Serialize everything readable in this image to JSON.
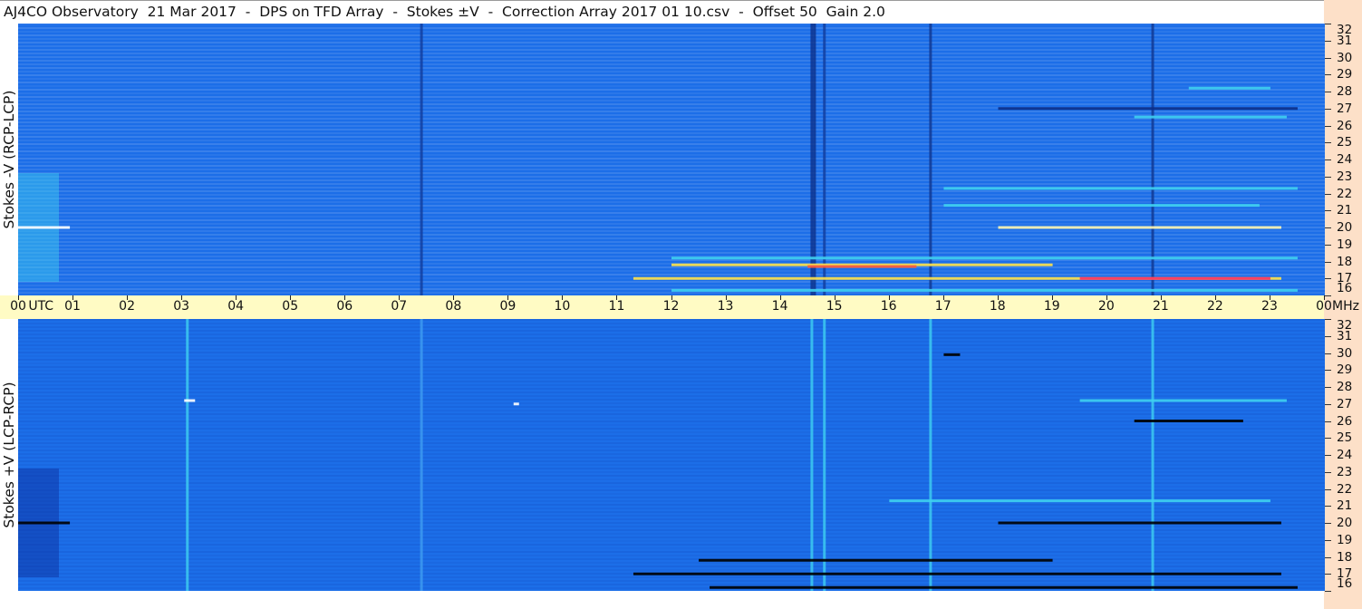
{
  "title": "AJ4CO Observatory  21 Mar 2017  -  DPS on TFD Array  -  Stokes ±V  -  Correction Array 2017 01 10.csv  -  Offset 50  Gain 2.0",
  "colors": {
    "background": "#1c6ee8",
    "band": "#fffbc4",
    "strip": "#fde0c8"
  },
  "chart_data": [
    {
      "type": "heatmap",
      "name_label": "Stokes -V (RCP-LCP)",
      "x_axis": {
        "unit": "UTC",
        "ticks": [
          "00",
          "01",
          "02",
          "03",
          "04",
          "05",
          "06",
          "07",
          "08",
          "09",
          "10",
          "11",
          "12",
          "13",
          "14",
          "15",
          "16",
          "17",
          "18",
          "19",
          "20",
          "21",
          "22",
          "23",
          "00"
        ]
      },
      "y_axis": {
        "unit": "MHz",
        "range": [
          16,
          32
        ],
        "ticks": [
          "32",
          "31",
          "30",
          "29",
          "28",
          "27",
          "26",
          "25",
          "24",
          "23",
          "22",
          "21",
          "20",
          "19",
          "18",
          "17",
          "16"
        ]
      },
      "colormap": [
        "#0a2c9c",
        "#1c6ee8",
        "#3fd0f0",
        "#ffe24a",
        "#ff3030"
      ],
      "features": [
        {
          "kind": "vline",
          "utc": 7.4,
          "color": "#123c9c"
        },
        {
          "kind": "vline",
          "utc": 14.57,
          "color": "#0c2f88"
        },
        {
          "kind": "vline",
          "utc": 14.62,
          "color": "#0c2f88"
        },
        {
          "kind": "vline",
          "utc": 14.8,
          "color": "#123c9c"
        },
        {
          "kind": "vline",
          "utc": 16.75,
          "color": "#10368f"
        },
        {
          "kind": "vline",
          "utc": 20.83,
          "color": "#10368f"
        },
        {
          "kind": "hseg",
          "mhz": 20.0,
          "utc_start": 0.0,
          "utc_end": 0.95,
          "color": "#ffffff"
        },
        {
          "kind": "hseg",
          "mhz": 20.0,
          "utc_start": 18.0,
          "utc_end": 23.2,
          "color": "#fff6b0"
        },
        {
          "kind": "hseg",
          "mhz": 18.2,
          "utc_start": 12.0,
          "utc_end": 23.5,
          "color": "#3fd0f0"
        },
        {
          "kind": "hseg",
          "mhz": 17.8,
          "utc_start": 12.0,
          "utc_end": 19.0,
          "color": "#ffe24a"
        },
        {
          "kind": "hseg",
          "mhz": 17.7,
          "utc_start": 14.5,
          "utc_end": 16.5,
          "color": "#ff5a3a"
        },
        {
          "kind": "hseg",
          "mhz": 17.0,
          "utc_start": 11.3,
          "utc_end": 23.2,
          "color": "#ffe24a"
        },
        {
          "kind": "hseg",
          "mhz": 17.0,
          "utc_start": 19.5,
          "utc_end": 23.0,
          "color": "#ff3060"
        },
        {
          "kind": "hseg",
          "mhz": 16.3,
          "utc_start": 12.0,
          "utc_end": 23.5,
          "color": "#3fd0f0"
        },
        {
          "kind": "hseg",
          "mhz": 22.3,
          "utc_start": 17.0,
          "utc_end": 23.5,
          "color": "#3fd0f0"
        },
        {
          "kind": "hseg",
          "mhz": 21.3,
          "utc_start": 17.0,
          "utc_end": 22.8,
          "color": "#3fd0f0"
        },
        {
          "kind": "hseg",
          "mhz": 27.0,
          "utc_start": 18.0,
          "utc_end": 23.5,
          "color": "#0c2f88"
        },
        {
          "kind": "hseg",
          "mhz": 28.2,
          "utc_start": 21.5,
          "utc_end": 23.0,
          "color": "#3fd0f0"
        },
        {
          "kind": "hseg",
          "mhz": 26.5,
          "utc_start": 20.5,
          "utc_end": 23.3,
          "color": "#3fd0f0"
        }
      ]
    },
    {
      "type": "heatmap",
      "name_label": "Stokes +V (LCP-RCP)",
      "x_axis": {
        "unit": "UTC",
        "ticks": [
          "00",
          "01",
          "02",
          "03",
          "04",
          "05",
          "06",
          "07",
          "08",
          "09",
          "10",
          "11",
          "12",
          "13",
          "14",
          "15",
          "16",
          "17",
          "18",
          "19",
          "20",
          "21",
          "22",
          "23",
          "00"
        ]
      },
      "y_axis": {
        "unit": "MHz",
        "range": [
          16,
          32
        ],
        "ticks": [
          "32",
          "31",
          "30",
          "29",
          "28",
          "27",
          "26",
          "25",
          "24",
          "23",
          "22",
          "21",
          "20",
          "19",
          "18",
          "17",
          "16"
        ]
      },
      "colormap": [
        "#000000",
        "#0a2c9c",
        "#1c6ee8",
        "#3fd0f0",
        "#ffffff"
      ],
      "features": [
        {
          "kind": "vline",
          "utc": 3.1,
          "color": "#3fd0f0"
        },
        {
          "kind": "vline",
          "utc": 7.4,
          "color": "#3f9cf0"
        },
        {
          "kind": "vline",
          "utc": 14.57,
          "color": "#3fd0f0"
        },
        {
          "kind": "vline",
          "utc": 14.8,
          "color": "#3fd0f0"
        },
        {
          "kind": "vline",
          "utc": 16.75,
          "color": "#3fd0f0"
        },
        {
          "kind": "vline",
          "utc": 20.83,
          "color": "#3fd0f0"
        },
        {
          "kind": "hseg",
          "mhz": 20.0,
          "utc_start": 0.0,
          "utc_end": 0.95,
          "color": "#000000"
        },
        {
          "kind": "hseg",
          "mhz": 20.0,
          "utc_start": 18.0,
          "utc_end": 23.2,
          "color": "#000000"
        },
        {
          "kind": "hseg",
          "mhz": 17.8,
          "utc_start": 12.5,
          "utc_end": 19.0,
          "color": "#000000"
        },
        {
          "kind": "hseg",
          "mhz": 17.0,
          "utc_start": 11.3,
          "utc_end": 23.2,
          "color": "#000000"
        },
        {
          "kind": "hseg",
          "mhz": 16.2,
          "utc_start": 12.7,
          "utc_end": 23.5,
          "color": "#000000"
        },
        {
          "kind": "hseg",
          "mhz": 21.3,
          "utc_start": 16.0,
          "utc_end": 23.0,
          "color": "#3fd0f0"
        },
        {
          "kind": "hseg",
          "mhz": 27.2,
          "utc_start": 19.5,
          "utc_end": 23.3,
          "color": "#3fd0f0"
        },
        {
          "kind": "hseg",
          "mhz": 26.0,
          "utc_start": 20.5,
          "utc_end": 22.5,
          "color": "#000000"
        },
        {
          "kind": "hseg",
          "mhz": 29.9,
          "utc_start": 17.0,
          "utc_end": 17.3,
          "color": "#000000"
        },
        {
          "kind": "hseg",
          "mhz": 27.2,
          "utc_start": 3.05,
          "utc_end": 3.25,
          "color": "#ffffff"
        },
        {
          "kind": "hseg",
          "mhz": 27.0,
          "utc_start": 9.1,
          "utc_end": 9.2,
          "color": "#ffffff"
        }
      ]
    }
  ]
}
